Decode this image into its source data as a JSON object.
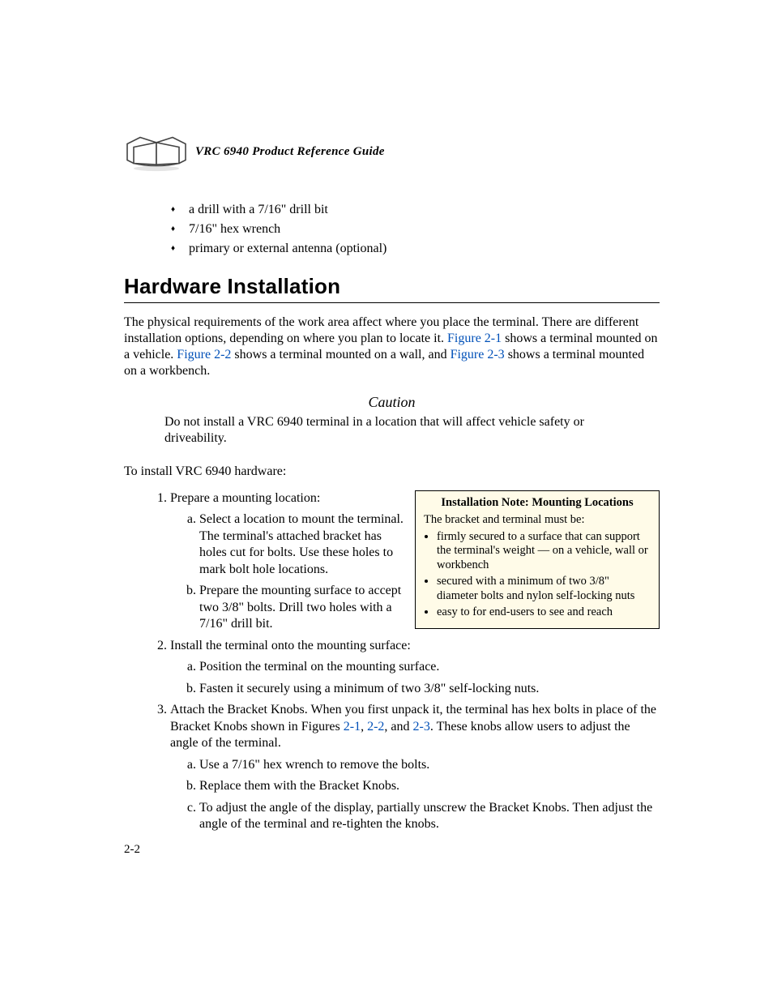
{
  "header": {
    "title": "VRC 6940 Product Reference Guide"
  },
  "top_bullets": [
    "a drill with a 7/16\" drill bit",
    "7/16\" hex wrench",
    "primary or external antenna (optional)"
  ],
  "section_heading": "Hardware Installation",
  "intro": {
    "p1a": "The physical requirements of the work area affect where you place the terminal. There are different installation options, depending on where you plan to locate it. ",
    "fig21": "Figure 2-1",
    "p1b": " shows a terminal mounted on a vehicle. ",
    "fig22": "Figure 2-2",
    "p1c": " shows a terminal mounted on a wall, and ",
    "fig23": "Figure 2-3",
    "p1d": " shows a terminal mounted on a workbench."
  },
  "caution": {
    "heading": "Caution",
    "text": "Do not install a VRC 6940 terminal in a location that will affect vehicle safety or driveability."
  },
  "install_intro": "To install VRC 6940 hardware:",
  "note": {
    "title": "Installation Note: Mounting Locations",
    "lead": "The bracket and terminal must be:",
    "items": [
      "firmly secured to a surface that can support the terminal's weight — on a vehicle, wall or workbench",
      "secured with a minimum of two 3/8\" diameter bolts and nylon self-locking nuts",
      "easy to for end-users to see and reach"
    ]
  },
  "steps": {
    "s1": "Prepare a mounting location:",
    "s1a": "Select a location to mount the terminal. The terminal's attached bracket has holes cut for bolts. Use these holes to mark bolt hole locations.",
    "s1b": "Prepare the mounting surface to accept two 3/8\" bolts. Drill two holes with a 7/16\" drill bit.",
    "s2": "Install the terminal onto the mounting surface:",
    "s2a": "Position the terminal on the mounting surface.",
    "s2b": "Fasten it securely using a minimum of two 3/8\" self-locking nuts.",
    "s3a": "Attach the Bracket Knobs. When you first unpack it, the terminal has hex bolts in place of the Bracket Knobs shown in Figures ",
    "s3_l1": "2-1",
    "s3b": ", ",
    "s3_l2": "2-2",
    "s3c": ", and ",
    "s3_l3": "2-3",
    "s3d": ". These knobs allow users to adjust the angle of the terminal.",
    "s3sa": "Use a 7/16\" hex wrench to remove the bolts.",
    "s3sb": "Replace them with the Bracket Knobs.",
    "s3sc": "To adjust the angle of the display, partially unscrew the Bracket Knobs. Then adjust the angle of the terminal and re-tighten the knobs."
  },
  "page_num": "2-2"
}
